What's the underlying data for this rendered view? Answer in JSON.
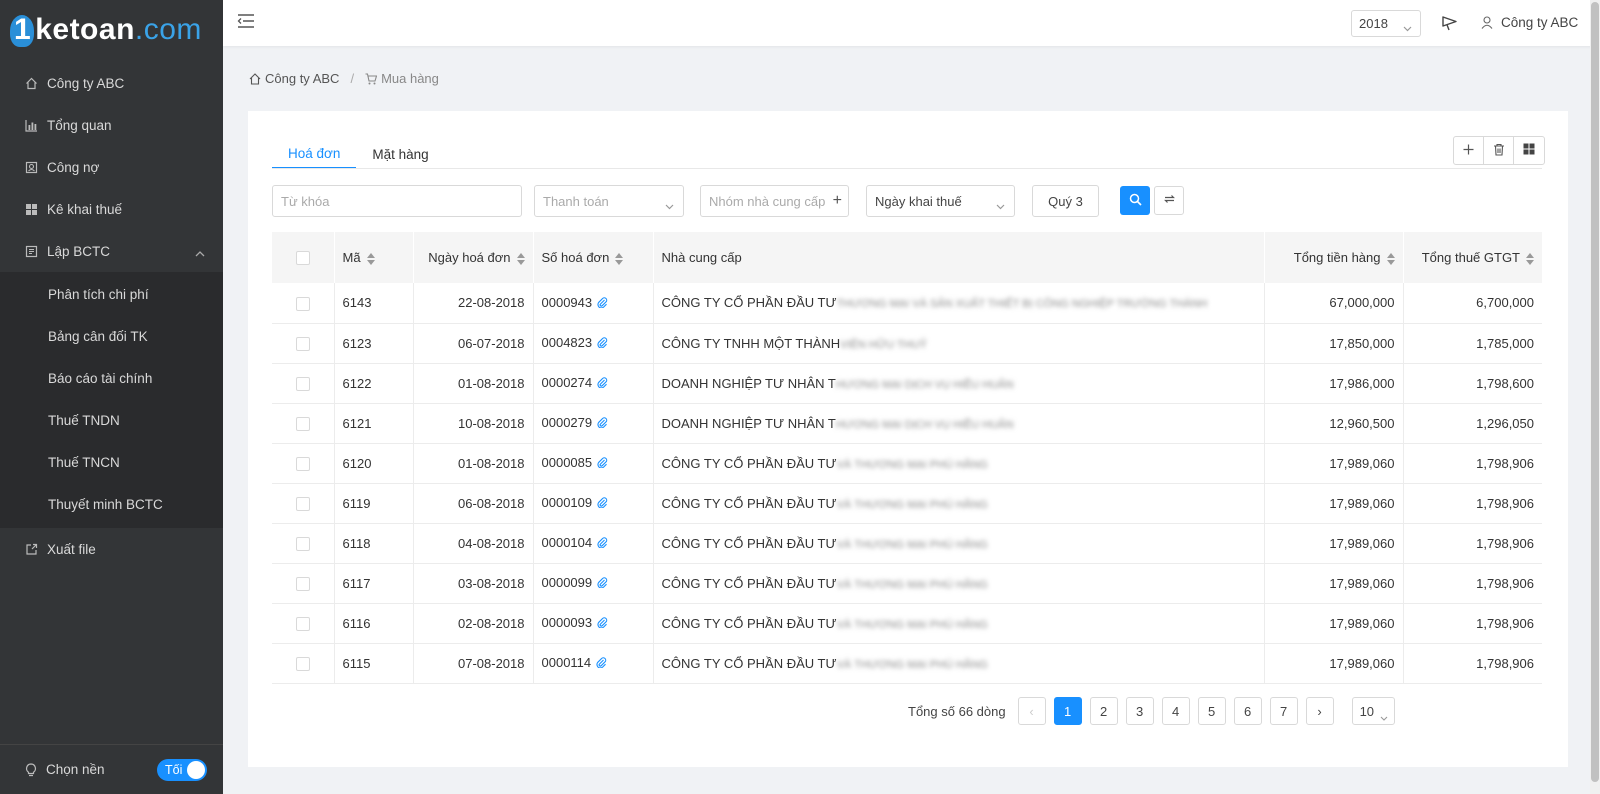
{
  "logo": {
    "one": "1",
    "ke": "ke",
    "toan": "toan",
    "com": ".com"
  },
  "sidebar": {
    "items": [
      {
        "label": "Công ty ABC",
        "icon": "home-icon"
      },
      {
        "label": "Tổng quan",
        "icon": "chart-icon"
      },
      {
        "label": "Công nợ",
        "icon": "ledger-icon"
      },
      {
        "label": "Kê khai thuế",
        "icon": "grid-icon"
      },
      {
        "label": "Lập BCTC",
        "icon": "report-icon"
      }
    ],
    "submenu": [
      {
        "label": "Phân tích chi phí"
      },
      {
        "label": "Bảng cân đối TK"
      },
      {
        "label": "Báo cáo tài chính"
      },
      {
        "label": "Thuế TNDN"
      },
      {
        "label": "Thuế TNCN"
      },
      {
        "label": "Thuyết minh BCTC"
      }
    ],
    "export": {
      "label": "Xuất file",
      "icon": "export-icon"
    },
    "theme_label": "Chọn nền",
    "toggle_label": "Tối"
  },
  "header": {
    "year": "2018",
    "company": "Công ty ABC"
  },
  "breadcrumb": {
    "home": "Công ty ABC",
    "current": "Mua hàng"
  },
  "tabs": [
    {
      "label": "Hoá đơn",
      "active": true
    },
    {
      "label": "Mặt hàng",
      "active": false
    }
  ],
  "filters": {
    "keyword_placeholder": "Từ khóa",
    "payment_placeholder": "Thanh toán",
    "supplier_group_placeholder": "Nhóm nhà cung cấp",
    "tax_date": "Ngày khai thuế",
    "quarter": "Quý 3"
  },
  "table": {
    "columns": {
      "code": "Mã",
      "date": "Ngày hoá đơn",
      "invoice": "Số hoá đơn",
      "supplier": "Nhà cung cấp",
      "total": "Tổng tiền hàng",
      "vat": "Tổng thuế GTGT"
    },
    "rows": [
      {
        "code": "6143",
        "date": "22-08-2018",
        "invoice": "0000943",
        "supplier": "CÔNG TY CỔ PHẦN ĐẦU TƯ",
        "supplier_rest": "THƯƠNG MẠI VÀ SẢN XUẤT THIẾT BỊ CÔNG NGHIỆP TRƯỜNG THÀNH",
        "total": "67,000,000",
        "vat": "6,700,000"
      },
      {
        "code": "6123",
        "date": "06-07-2018",
        "invoice": "0004823",
        "supplier": "CÔNG TY TNHH MỘT THÀNH",
        "supplier_rest": "VIÊN HỮU THUỶ",
        "total": "17,850,000",
        "vat": "1,785,000"
      },
      {
        "code": "6122",
        "date": "01-08-2018",
        "invoice": "0000274",
        "supplier": "DOANH NGHIỆP TƯ NHÂN T",
        "supplier_rest": "HƯƠNG MẠI DỊCH VỤ HIỀU HUÂN",
        "total": "17,986,000",
        "vat": "1,798,600"
      },
      {
        "code": "6121",
        "date": "10-08-2018",
        "invoice": "0000279",
        "supplier": "DOANH NGHIỆP TƯ NHÂN T",
        "supplier_rest": "HƯƠNG MẠI DỊCH VỤ HIỀU HUÂN",
        "total": "12,960,500",
        "vat": "1,296,050"
      },
      {
        "code": "6120",
        "date": "01-08-2018",
        "invoice": "0000085",
        "supplier": "CÔNG TY CỔ PHẦN ĐẦU TƯ",
        "supplier_rest": "VÀ THƯƠNG MẠI PHÚ HẰNG",
        "total": "17,989,060",
        "vat": "1,798,906"
      },
      {
        "code": "6119",
        "date": "06-08-2018",
        "invoice": "0000109",
        "supplier": "CÔNG TY CỔ PHẦN ĐẦU TƯ",
        "supplier_rest": "VÀ THƯƠNG MẠI PHÚ HẰNG",
        "total": "17,989,060",
        "vat": "1,798,906"
      },
      {
        "code": "6118",
        "date": "04-08-2018",
        "invoice": "0000104",
        "supplier": "CÔNG TY CỔ PHẦN ĐẦU TƯ",
        "supplier_rest": "VÀ THƯƠNG MẠI PHÚ HẰNG",
        "total": "17,989,060",
        "vat": "1,798,906"
      },
      {
        "code": "6117",
        "date": "03-08-2018",
        "invoice": "0000099",
        "supplier": "CÔNG TY CỔ PHẦN ĐẦU TƯ",
        "supplier_rest": "VÀ THƯƠNG MẠI PHÚ HẰNG",
        "total": "17,989,060",
        "vat": "1,798,906"
      },
      {
        "code": "6116",
        "date": "02-08-2018",
        "invoice": "0000093",
        "supplier": "CÔNG TY CỔ PHẦN ĐẦU TƯ",
        "supplier_rest": "VÀ THƯƠNG MẠI PHÚ HẰNG",
        "total": "17,989,060",
        "vat": "1,798,906"
      },
      {
        "code": "6115",
        "date": "07-08-2018",
        "invoice": "0000114",
        "supplier": "CÔNG TY CỔ PHẦN ĐẦU TƯ",
        "supplier_rest": "VÀ THƯƠNG MẠI PHÚ HẰNG",
        "total": "17,989,060",
        "vat": "1,798,906"
      }
    ]
  },
  "pagination": {
    "total_label": "Tổng số 66 dòng",
    "prev": "‹",
    "next": "›",
    "pages": [
      "1",
      "2",
      "3",
      "4",
      "5",
      "6",
      "7"
    ],
    "current": "1",
    "page_size": "10"
  },
  "colors": {
    "primary": "#1890ff",
    "sidebar": "#333537",
    "submenu": "#2a2b2d"
  }
}
